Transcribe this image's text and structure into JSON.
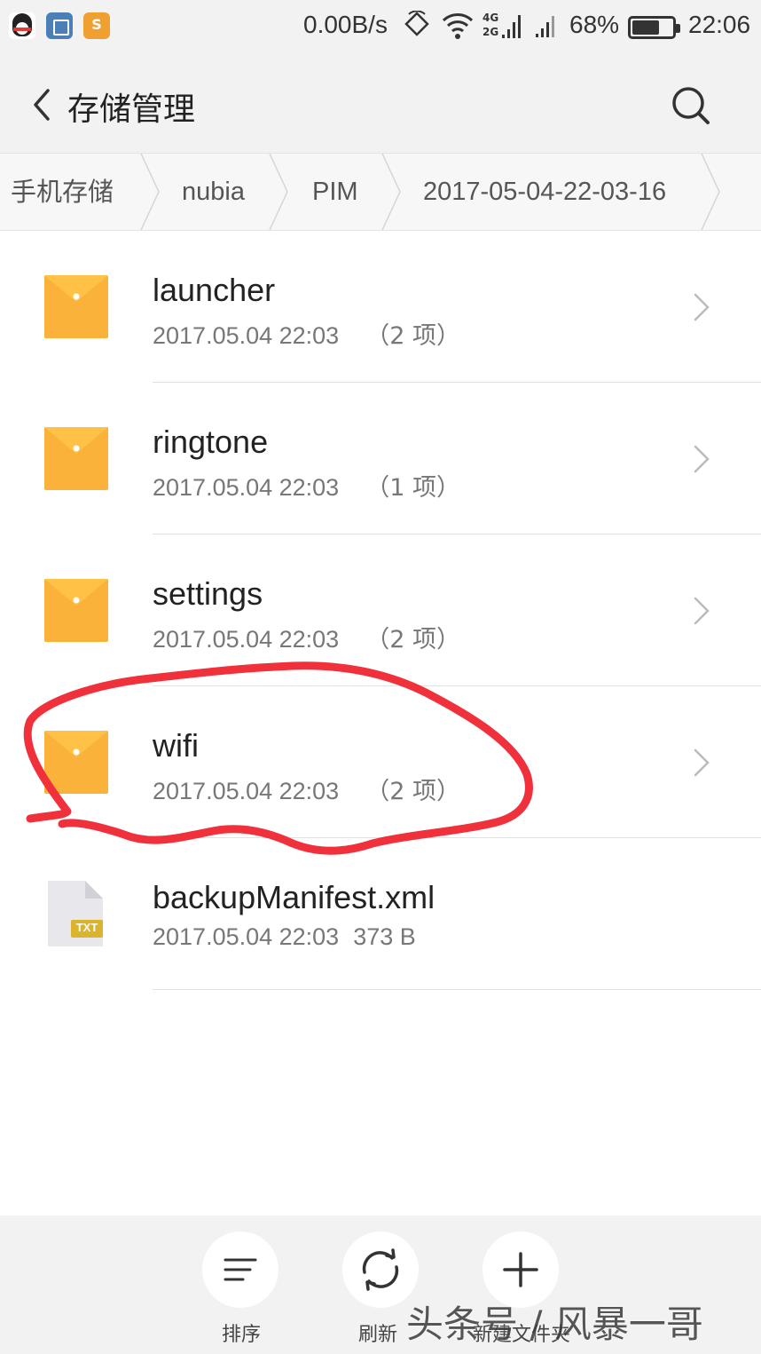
{
  "status_bar": {
    "app_icons": [
      "qq-icon",
      "gallery-icon",
      "note-icon"
    ],
    "network_speed": "0.00B/s",
    "signal_labels": [
      "4G",
      "2G"
    ],
    "battery_level": 0.68,
    "battery_percent": "68%",
    "time": "22:06"
  },
  "app_bar": {
    "title": "存储管理",
    "back_icon": "back-arrow-icon",
    "search_icon": "search-icon"
  },
  "breadcrumb": [
    "手机存储",
    "nubia",
    "PIM",
    "2017-05-04-22-03-16"
  ],
  "files": [
    {
      "name": "launcher",
      "date": "2017.05.04  22:03",
      "info": "（2 项）",
      "type": "folder"
    },
    {
      "name": "ringtone",
      "date": "2017.05.04  22:03",
      "info": "（1 项）",
      "type": "folder"
    },
    {
      "name": "settings",
      "date": "2017.05.04  22:03",
      "info": "（2 项）",
      "type": "folder"
    },
    {
      "name": "wifi",
      "date": "2017.05.04  22:03",
      "info": "（2 项）",
      "type": "folder"
    },
    {
      "name": "backupManifest.xml",
      "date": "2017.05.04  22:03",
      "info": "373 B",
      "type": "file",
      "file_badge": "TXT"
    }
  ],
  "bottom_actions": [
    {
      "label": "排序",
      "icon": "sort-icon"
    },
    {
      "label": "刷新",
      "icon": "refresh-icon"
    },
    {
      "label": "新建文件夹",
      "icon": "plus-icon"
    }
  ],
  "watermark": "头条号 / 风暴一哥",
  "colors": {
    "folder": "#FBB23A",
    "annotation": "#F0303A",
    "bar_background": "#F2F2F2"
  }
}
